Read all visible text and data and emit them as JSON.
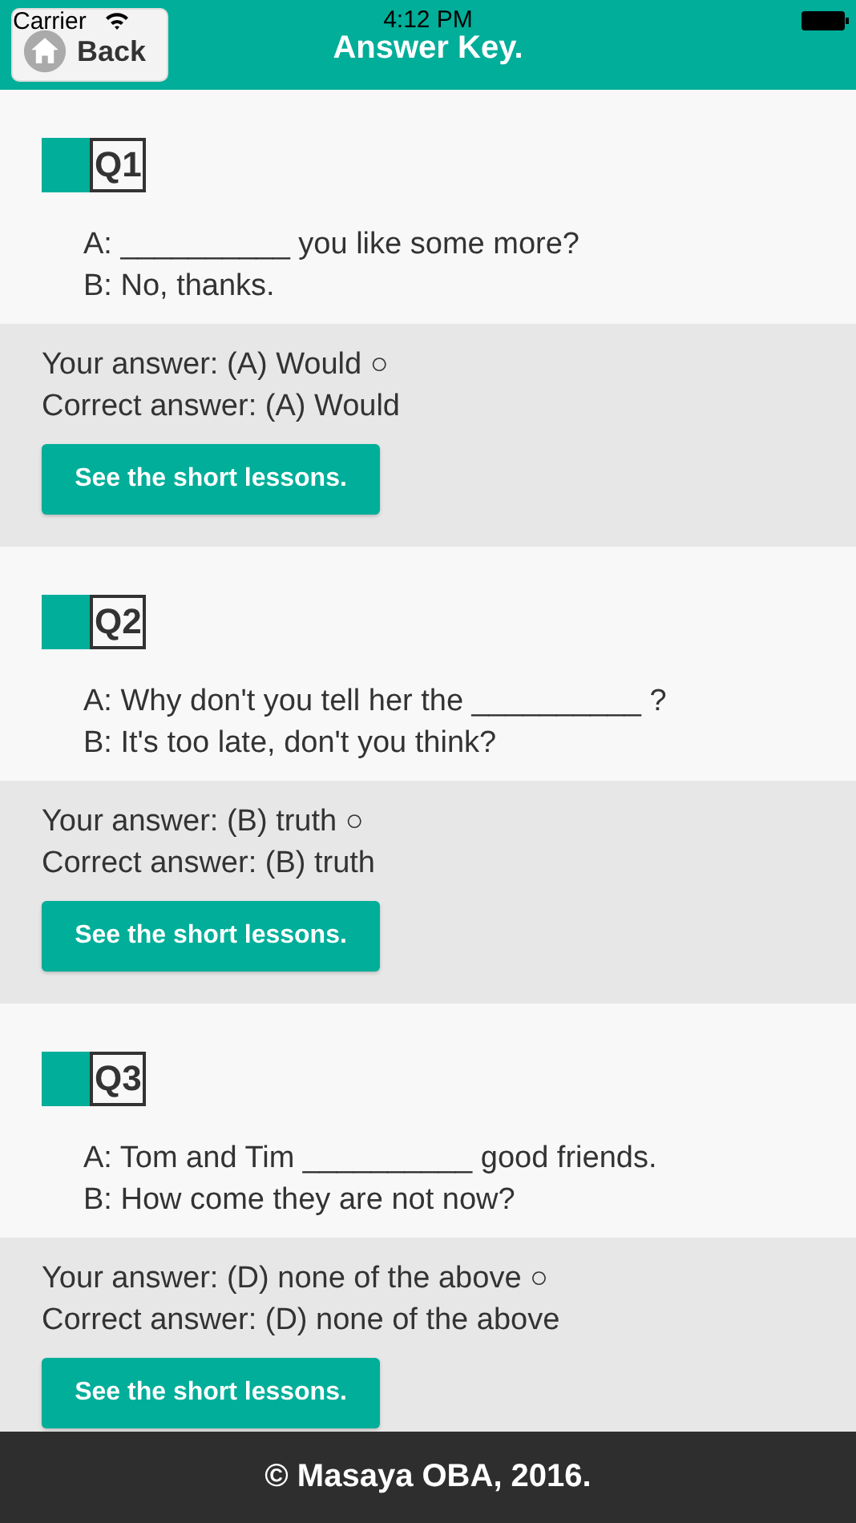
{
  "status_bar": {
    "carrier": "Carrier",
    "time": "4:12 PM"
  },
  "nav": {
    "back": "Back",
    "title": "Answer Key."
  },
  "questions": [
    {
      "label": "Q1",
      "lines": [
        "A: __________ you like some more?",
        "B: No, thanks."
      ],
      "your_answer": "Your answer: (A) Would ○",
      "correct_answer": "Correct answer: (A) Would",
      "button": "See the short lessons."
    },
    {
      "label": "Q2",
      "lines": [
        "A: Why don't you tell her the __________ ?",
        "B: It's too late, don't you think?"
      ],
      "your_answer": "Your answer: (B) truth ○",
      "correct_answer": "Correct answer: (B) truth",
      "button": "See the short lessons."
    },
    {
      "label": "Q3",
      "lines": [
        "A: Tom and Tim __________ good friends.",
        "B: How come they are not now?"
      ],
      "your_answer": "Your answer: (D) none of the above ○",
      "correct_answer": "Correct answer: (D) none of the above",
      "button": "See the short lessons."
    }
  ],
  "footer": "© Masaya OBA, 2016."
}
